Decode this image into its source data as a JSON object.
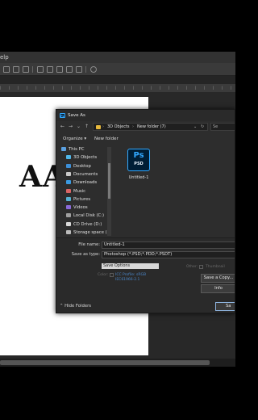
{
  "app": {
    "menu_fragment": "elp"
  },
  "dialog": {
    "title": "Save As",
    "nav": {
      "back": "←",
      "forward": "→",
      "up": "↑",
      "history": "⌄",
      "crumb_sep": "›",
      "crumbs": [
        "3D Objects",
        "New folder (7)"
      ],
      "dropdown": "⌄",
      "refresh": "↻",
      "search_placeholder": "Se"
    },
    "toolbar": {
      "organize": "Organize ▾",
      "new_folder": "New folder"
    },
    "nav_pane": [
      {
        "label": "This PC",
        "icon": "computer-icon",
        "kind": "pc",
        "indent": 0
      },
      {
        "label": "3D Objects",
        "icon": "cube-icon",
        "kind": "obj",
        "indent": 1
      },
      {
        "label": "Desktop",
        "icon": "desktop-icon",
        "kind": "desk",
        "indent": 1
      },
      {
        "label": "Documents",
        "icon": "document-icon",
        "kind": "docs",
        "indent": 1
      },
      {
        "label": "Downloads",
        "icon": "download-icon",
        "kind": "down",
        "indent": 1
      },
      {
        "label": "Music",
        "icon": "music-icon",
        "kind": "music",
        "indent": 1
      },
      {
        "label": "Pictures",
        "icon": "picture-icon",
        "kind": "pics",
        "indent": 1
      },
      {
        "label": "Videos",
        "icon": "video-icon",
        "kind": "vids",
        "indent": 1
      },
      {
        "label": "Local Disk (C:)",
        "icon": "disk-icon",
        "kind": "disk",
        "indent": 1
      },
      {
        "label": "CD Drive (D:)",
        "icon": "cd-icon",
        "kind": "cd",
        "indent": 1
      },
      {
        "label": "Storage space (E:",
        "icon": "storage-icon",
        "kind": "stor",
        "indent": 1
      }
    ],
    "files": [
      {
        "name": "Untitled-1",
        "icon_text": "Ps",
        "icon_sub": "PSD"
      }
    ],
    "file_name_label": "File name:",
    "file_name_value": "Untitled-1",
    "save_type_label": "Save as type:",
    "save_type_value": "Photoshop (*.PSD;*.PDD;*.PSDT)",
    "save_options_label": "Save Options",
    "color_label": "Color:",
    "color_opt1": "ICC Profile: sRGB",
    "color_opt2": "IEC61966-2.1",
    "other_label": "Other:",
    "thumbnail_label": "Thumbnail",
    "save_copy_label": "Save a Copy...",
    "info_label": "Info",
    "save_label": "Sa",
    "hide_folders_label": "Hide Folders",
    "hide_folders_icon": "⌃"
  },
  "document": {
    "text": "AA"
  }
}
